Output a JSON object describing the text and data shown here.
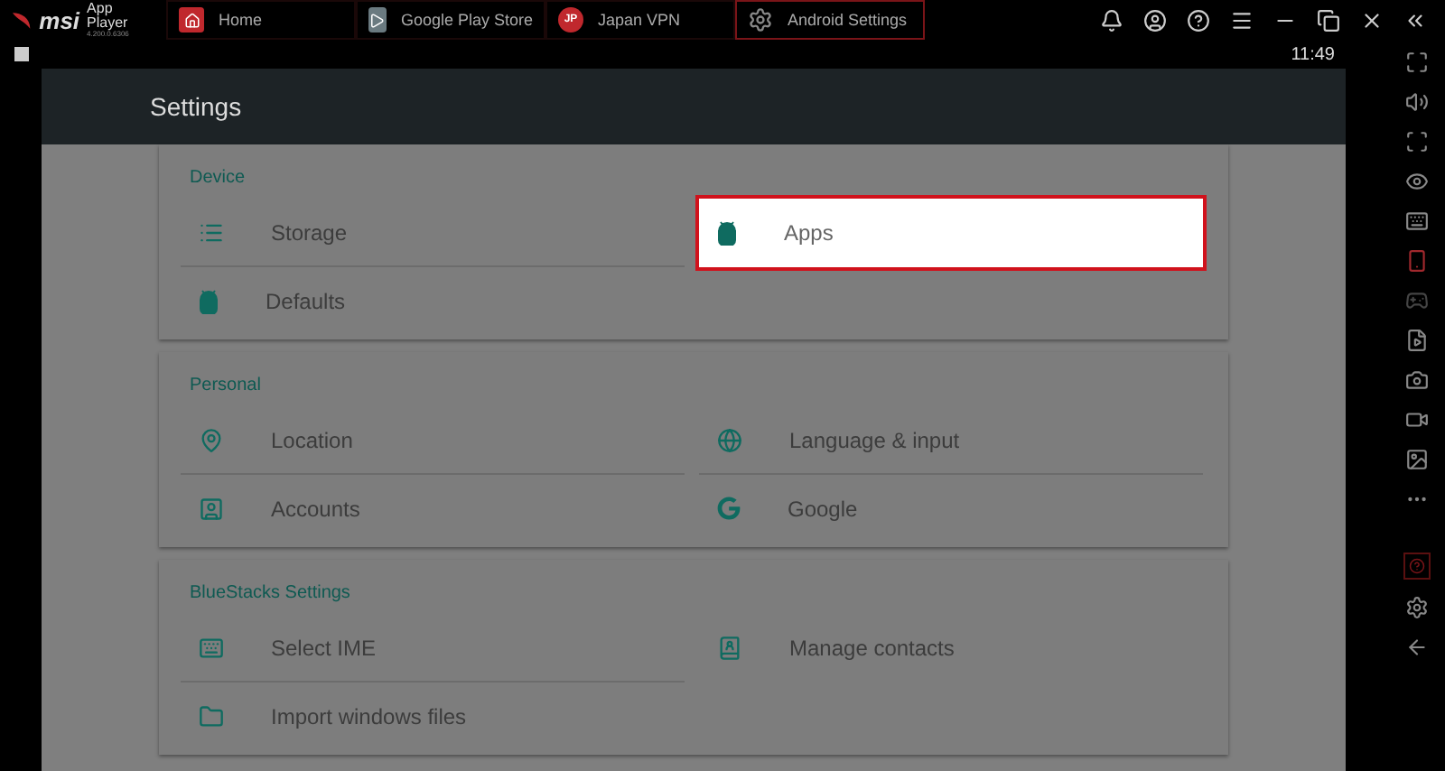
{
  "app": {
    "brand": "msi",
    "name": "App Player",
    "version": "4.200.0.6306"
  },
  "tabs": [
    {
      "label": "Home",
      "kind": "home",
      "selected": false
    },
    {
      "label": "Google Play Store",
      "kind": "store",
      "selected": false
    },
    {
      "label": "Japan VPN",
      "kind": "vpn",
      "badge": "JP",
      "selected": false
    },
    {
      "label": "Android Settings",
      "kind": "settings",
      "selected": true
    }
  ],
  "status_bar": {
    "time": "11:49"
  },
  "app_bar": {
    "title": "Settings"
  },
  "sections": [
    {
      "title": "Device",
      "items": [
        {
          "label": "Storage",
          "kind": "storage",
          "selected": false
        },
        {
          "label": "Apps",
          "kind": "android",
          "selected": true
        },
        {
          "label": "Defaults",
          "kind": "android",
          "selected": false
        }
      ]
    },
    {
      "title": "Personal",
      "items": [
        {
          "label": "Location",
          "kind": "location",
          "selected": false
        },
        {
          "label": "Language & input",
          "kind": "globe",
          "selected": false
        },
        {
          "label": "Accounts",
          "kind": "account",
          "selected": false
        },
        {
          "label": "Google",
          "kind": "google",
          "selected": false
        }
      ]
    },
    {
      "title": "BlueStacks Settings",
      "items": [
        {
          "label": "Select IME",
          "kind": "keyboard",
          "selected": false
        },
        {
          "label": "Manage contacts",
          "kind": "contacts",
          "selected": false
        },
        {
          "label": "Import windows files",
          "kind": "folder",
          "selected": false
        }
      ]
    }
  ]
}
